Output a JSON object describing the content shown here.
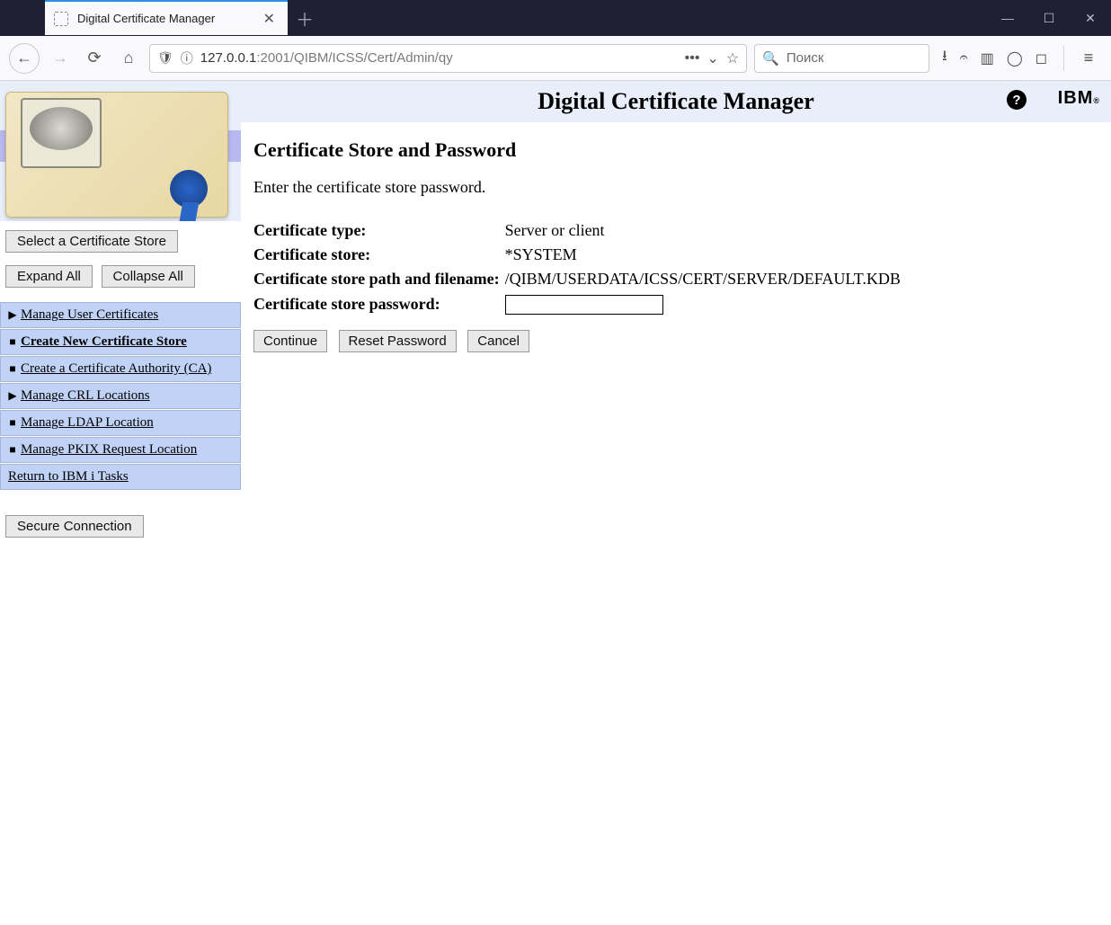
{
  "browser": {
    "tab_title": "Digital Certificate Manager",
    "url_host": "127.0.0.1",
    "url_port": ":2001",
    "url_path": "/QIBM/ICSS/Cert/Admin/qy",
    "search_placeholder": "Поиск"
  },
  "header": {
    "title": "Digital Certificate Manager",
    "ibm": "IBM"
  },
  "sidebar": {
    "select_store": "Select a Certificate Store",
    "expand_all": "Expand All",
    "collapse_all": "Collapse All",
    "items": [
      {
        "bullet": "▶",
        "label": "Manage User Certificates",
        "bold": false
      },
      {
        "bullet": "■",
        "label": "Create New Certificate Store",
        "bold": true
      },
      {
        "bullet": "■",
        "label": "Create a Certificate Authority (CA)",
        "bold": false
      },
      {
        "bullet": "▶",
        "label": "Manage CRL Locations",
        "bold": false
      },
      {
        "bullet": "■",
        "label": "Manage LDAP Location",
        "bold": false
      },
      {
        "bullet": "■",
        "label": "Manage PKIX Request Location",
        "bold": false
      }
    ],
    "return_link": "Return to IBM i Tasks",
    "secure_connection": "Secure Connection"
  },
  "main": {
    "heading": "Certificate Store and Password",
    "intro": "Enter the certificate store password.",
    "rows": {
      "cert_type_label": "Certificate type:",
      "cert_type_value": "Server or client",
      "cert_store_label": "Certificate store:",
      "cert_store_value": "*SYSTEM",
      "cert_path_label": "Certificate store path and filename:",
      "cert_path_value": "/QIBM/USERDATA/ICSS/CERT/SERVER/DEFAULT.KDB",
      "cert_pw_label": "Certificate store password:"
    },
    "buttons": {
      "continue": "Continue",
      "reset": "Reset Password",
      "cancel": "Cancel"
    }
  }
}
